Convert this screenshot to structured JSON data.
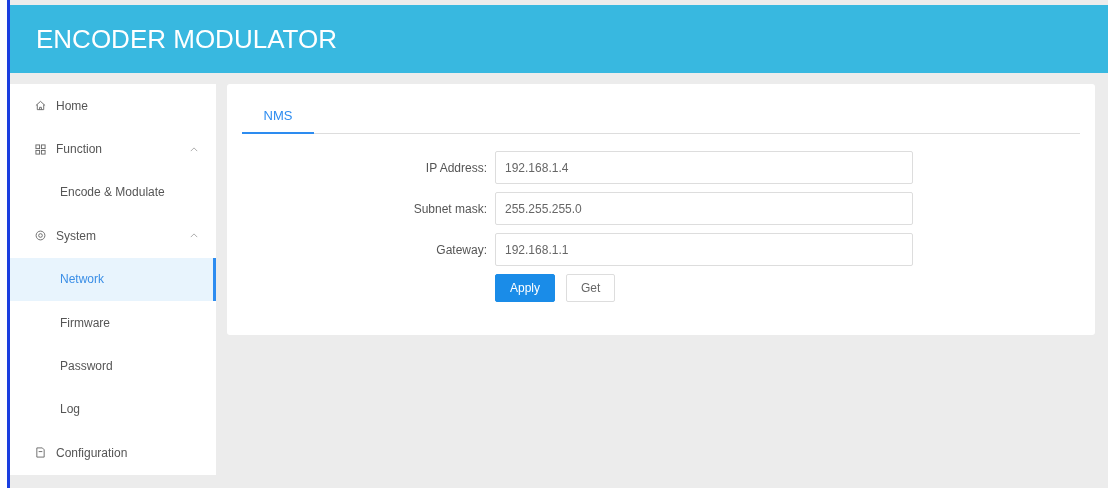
{
  "header": {
    "title": "ENCODER MODULATOR"
  },
  "sidebar": {
    "items": [
      {
        "label": "Home",
        "kind": "home",
        "selected": false
      },
      {
        "label": "Function",
        "kind": "function",
        "expanded": true,
        "selected": false,
        "children": [
          {
            "label": "Encode & Modulate",
            "selected": false
          }
        ]
      },
      {
        "label": "System",
        "kind": "system",
        "expanded": true,
        "selected": false,
        "children": [
          {
            "label": "Network",
            "selected": true
          },
          {
            "label": "Firmware",
            "selected": false
          },
          {
            "label": "Password",
            "selected": false
          },
          {
            "label": "Log",
            "selected": false
          }
        ]
      },
      {
        "label": "Configuration",
        "kind": "configuration",
        "selected": false
      }
    ]
  },
  "tabs": [
    {
      "label": "NMS",
      "selected": true
    }
  ],
  "form": {
    "fields": [
      {
        "label": "IP Address:",
        "value": "192.168.1.4"
      },
      {
        "label": "Subnet mask:",
        "value": "255.255.255.0"
      },
      {
        "label": "Gateway:",
        "value": "192.168.1.1"
      }
    ],
    "buttons": [
      {
        "label": "Apply",
        "kind": "primary"
      },
      {
        "label": "Get",
        "kind": "default"
      }
    ]
  }
}
